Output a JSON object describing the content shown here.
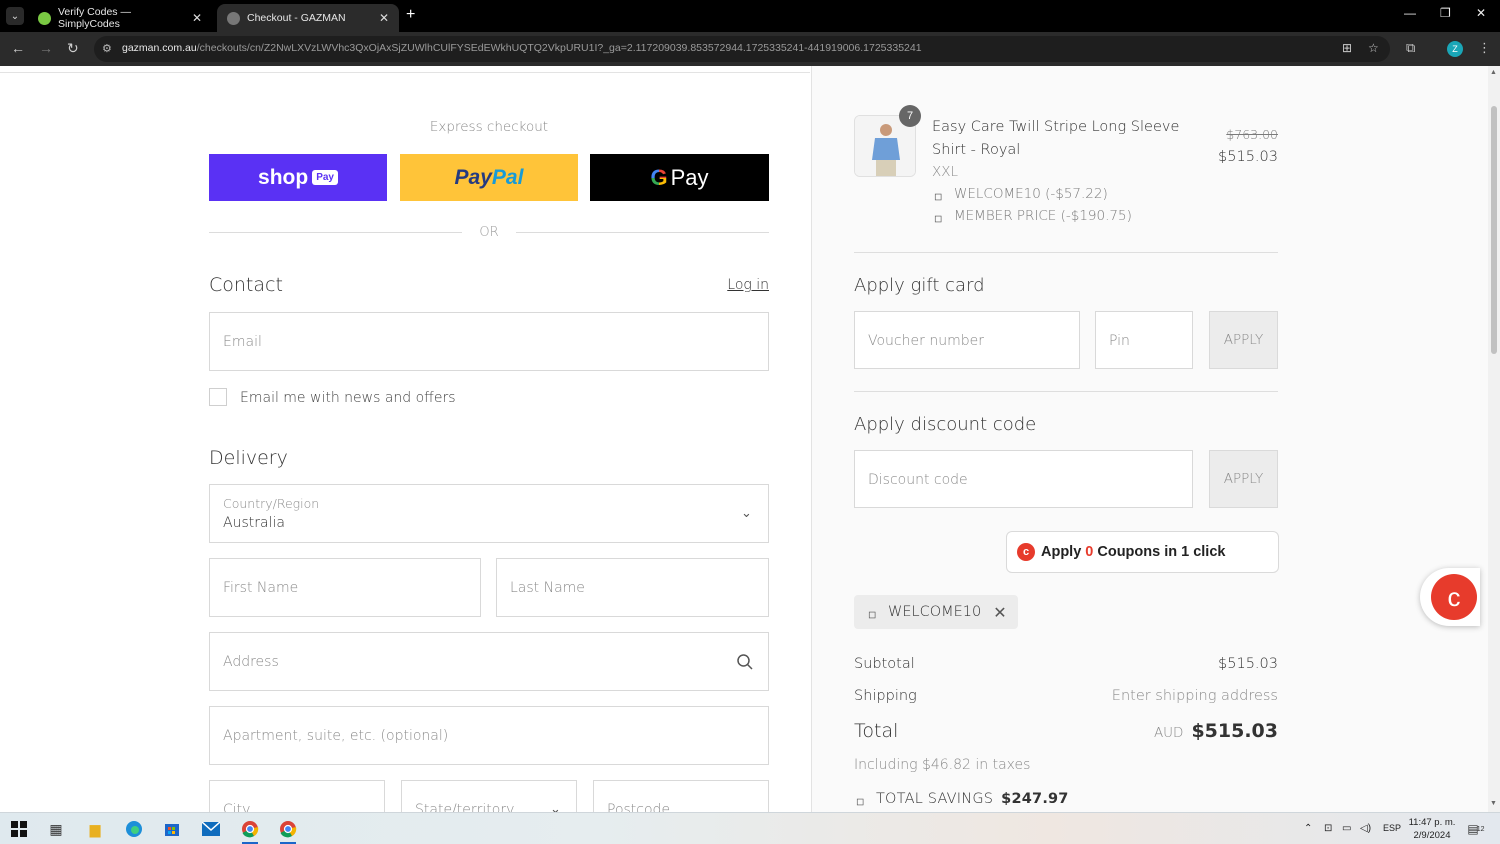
{
  "browser": {
    "tabs": [
      {
        "title": "Verify Codes — SimplyCodes",
        "active": false
      },
      {
        "title": "Checkout - GAZMAN",
        "active": true
      }
    ],
    "url_host": "gazman.com.au",
    "url_path": "/checkouts/cn/Z2NwLXVzLWVhc3QxOjAxSjZUWlhCUlFYSEdEWkhUQTQ2VkpURU1I?_ga=2.117209039.853572944.1725335241-441919006.1725335241",
    "profile_initial": "Z"
  },
  "express": {
    "title": "Express checkout",
    "shop_label": "shop",
    "shop_pay_label": "Pay",
    "paypal_label_1": "Pay",
    "paypal_label_2": "Pal",
    "gpay_g": "G",
    "gpay_label": "Pay",
    "or_label": "OR"
  },
  "contact": {
    "title": "Contact",
    "login_label": "Log in",
    "email_placeholder": "Email",
    "newsletter_label": "Email me with news and offers"
  },
  "delivery": {
    "title": "Delivery",
    "country_label": "Country/Region",
    "country_value": "Australia",
    "first_name_placeholder": "First Name",
    "last_name_placeholder": "Last Name",
    "address_placeholder": "Address",
    "apartment_placeholder": "Apartment, suite, etc. (optional)",
    "city_placeholder": "City",
    "state_placeholder": "State/territory",
    "postcode_placeholder": "Postcode"
  },
  "order": {
    "quantity": "7",
    "product_name": "Easy Care Twill Stripe Long Sleeve Shirt - Royal",
    "variant": "XXL",
    "discounts": [
      "WELCOME10 (-$57.22)",
      "MEMBER PRICE (-$190.75)"
    ],
    "original_price": "$763.00",
    "price": "$515.03"
  },
  "gift_card": {
    "title": "Apply gift card",
    "voucher_placeholder": "Voucher number",
    "pin_placeholder": "Pin",
    "apply_label": "APPLY"
  },
  "discount": {
    "title": "Apply discount code",
    "code_placeholder": "Discount code",
    "apply_label": "APPLY",
    "coupon_prefix": "Apply",
    "coupon_count": "0",
    "coupon_suffix": "Coupons in 1 click",
    "applied_code": "WELCOME10"
  },
  "summary": {
    "subtotal_label": "Subtotal",
    "subtotal_value": "$515.03",
    "shipping_label": "Shipping",
    "shipping_value": "Enter shipping address",
    "total_label": "Total",
    "currency": "AUD",
    "total_value": "$515.03",
    "taxes_note": "Including $46.82 in taxes",
    "savings_label": "TOTAL SAVINGS",
    "savings_value": "$247.97"
  },
  "taskbar": {
    "language": "ESP",
    "time": "11:47 p. m.",
    "date": "2/9/2024",
    "notification_count": "12"
  },
  "colors": {
    "shop_pay": "#5a31f4",
    "paypal": "#ffc439",
    "gpay": "#000000",
    "coupon_accent": "#e73b2c"
  }
}
